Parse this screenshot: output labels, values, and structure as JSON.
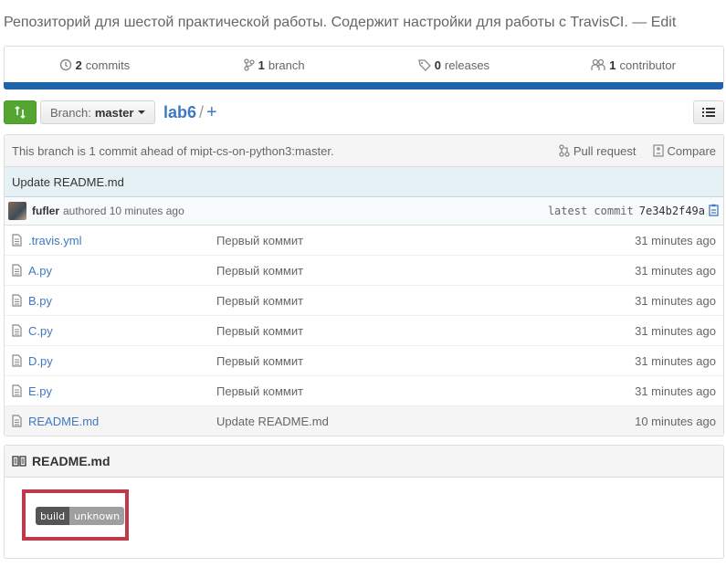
{
  "repo": {
    "description": "Репозиторий для шестой практической работы. Содержит настройки для работы с TravisCI.",
    "edit_label": "— Edit"
  },
  "summary": {
    "commits_count": "2",
    "commits_label": "commits",
    "branch_count": "1",
    "branch_label": "branch",
    "releases_count": "0",
    "releases_label": "releases",
    "contributor_count": "1",
    "contributor_label": "contributor",
    "language_color": "#1e64a8"
  },
  "nav": {
    "branch_prefix": "Branch:",
    "branch_name": "master",
    "path_root": "lab6",
    "path_separator": "/",
    "add_label": "+"
  },
  "tease": {
    "message": "This branch is 1 commit ahead of mipt-cs-on-python3:master.",
    "pull_request_label": "Pull request",
    "compare_label": "Compare"
  },
  "latest_commit": {
    "title": "Update README.md",
    "author": "fufler",
    "authored": "authored 10 minutes ago",
    "latest_label": "latest commit",
    "sha": "7e34b2f49a"
  },
  "files": [
    {
      "name": ".travis.yml",
      "message": "Первый коммит",
      "age": "31 minutes ago"
    },
    {
      "name": "A.py",
      "message": "Первый коммит",
      "age": "31 minutes ago"
    },
    {
      "name": "B.py",
      "message": "Первый коммит",
      "age": "31 minutes ago"
    },
    {
      "name": "C.py",
      "message": "Первый коммит",
      "age": "31 minutes ago"
    },
    {
      "name": "D.py",
      "message": "Первый коммит",
      "age": "31 minutes ago"
    },
    {
      "name": "E.py",
      "message": "Первый коммит",
      "age": "31 minutes ago"
    },
    {
      "name": "README.md",
      "message": "Update README.md",
      "age": "10 minutes ago"
    }
  ],
  "readme": {
    "title": "README.md",
    "badge_left": "build",
    "badge_right": "unknown",
    "highlight_color": "#c0394b"
  }
}
